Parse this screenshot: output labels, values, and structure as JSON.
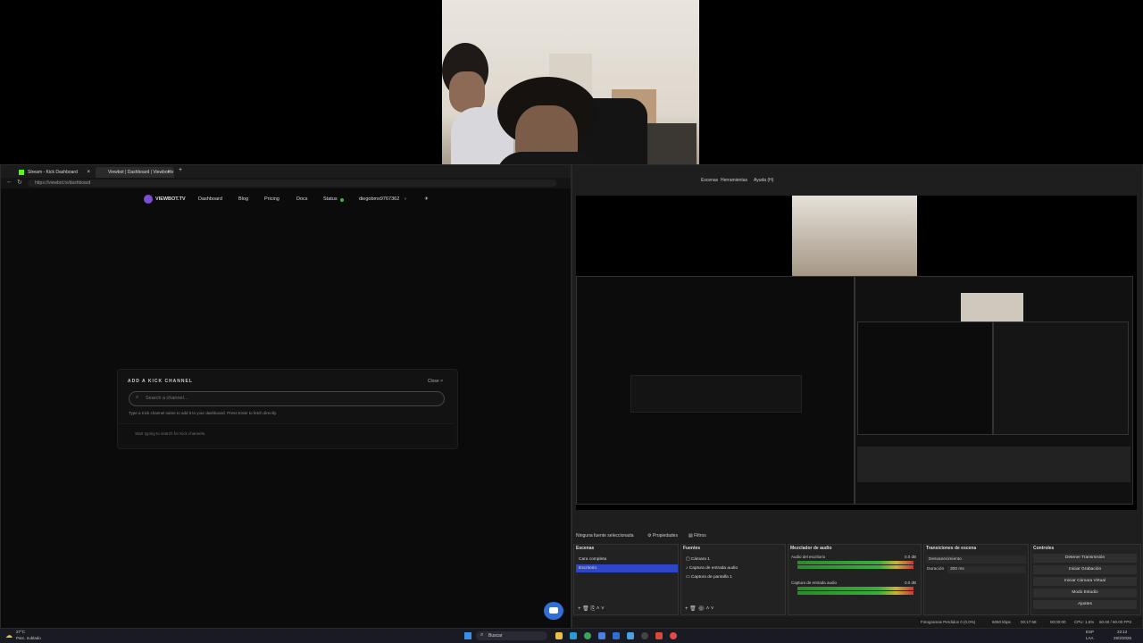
{
  "webcam": {
    "alt": "webcam feed"
  },
  "browser": {
    "tabs": [
      {
        "label": "Stream - Kick Dashboard",
        "active": false
      },
      {
        "label": "Viewbot | Dashboard | Viewbot.tv",
        "active": true
      }
    ],
    "new_tab": "+",
    "url": "https://viewbot.tv/dashboard",
    "nav": {
      "brand": "VIEWBOT.TV",
      "links": [
        "Dashboard",
        "Blog",
        "Pricing",
        "Docs",
        "Status"
      ],
      "user": "diegobmx9767362"
    },
    "modal": {
      "title": "ADD A KICK CHANNEL",
      "close": "Close",
      "search_placeholder": "Search a channel...",
      "help": "Type a Kick channel name to add it to your dashboard. Press Enter to fetch directly.",
      "hint": "Start typing to search for Kick channels."
    }
  },
  "obs": {
    "menu": [
      "Escenas",
      "Herramientas",
      "Ayuda (H)"
    ],
    "no_source": "Ninguna fuente seleccionada",
    "properties": "Propiedades",
    "filters": "Filtros",
    "scenes": {
      "title": "Escenas",
      "items": [
        "Cara completa",
        "Escritorio"
      ],
      "selected": 1
    },
    "sources": {
      "title": "Fuentes",
      "items": [
        "Cámara 1",
        "Captura de entrada audio",
        "Captura de pantalla 1"
      ]
    },
    "mixer": {
      "title": "Mezclador de audio",
      "channels": [
        {
          "name": "Audio del escritorio",
          "db": "0.0 dB",
          "level": 0.9
        },
        {
          "name": "Captura de entrada audio",
          "db": "0.0 dB",
          "level": 0.8
        }
      ]
    },
    "transitions": {
      "title": "Transiciones de escena",
      "value": "Desvanecimiento",
      "duration_label": "Duración",
      "duration": "300 ms"
    },
    "controls": {
      "title": "Controles",
      "buttons": [
        "Detener Transmisión",
        "Iniciar Grabación",
        "Iniciar Cámara Virtual",
        "Modo Estudio",
        "Ajustes"
      ]
    },
    "status": {
      "dropped": "Fotogramas Perdidos 0 (0.0%)",
      "bitrate": "6050 kbps",
      "stream_time": "00:17:58",
      "rec_time": "00:00:00",
      "cpu": "CPU: 1.5%",
      "fps": "60.00 / 60.00 FPS"
    }
  },
  "taskbar": {
    "weather_temp": "27°C",
    "weather_desc": "Parc. nublado",
    "search": "Buscar",
    "lang": "ESP",
    "lang2": "LAA",
    "time": "22:12",
    "date": "28/2/2026"
  },
  "colors": {
    "accent": "#2d47c8",
    "live": "#4caf50",
    "danger": "#c23a3a"
  }
}
